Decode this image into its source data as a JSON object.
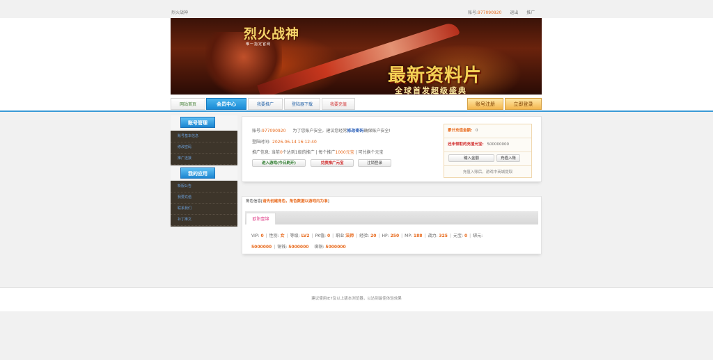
{
  "topbar": {
    "site_name": "烈火战神",
    "account_label": "账号:",
    "account_value": "977090920",
    "logout": "退出",
    "promote": "推广"
  },
  "banner": {
    "logo_text": "烈火战神",
    "logo_sub": "唯一指定官网",
    "headline": "最新资料片",
    "subline": "全球首发超级盛典"
  },
  "nav": {
    "tabs": [
      "网站首页",
      "会员中心",
      "我要推广",
      "登陆器下载",
      "我要充值"
    ],
    "register": "账号注册",
    "login": "立即登录"
  },
  "sidebar": {
    "account_head": "账号管理",
    "account_items": [
      "账号基本信息",
      "修改密码",
      "推广连接"
    ],
    "app_head": "我的应用",
    "app_items": [
      "新服公告",
      "我要充值",
      "联系我们",
      "补丁推文"
    ]
  },
  "account": {
    "account_label": "账号:",
    "account_value": "977090920",
    "security_prefix": "为了您账户安全，建议您经常",
    "security_link": "修改密码",
    "security_suffix": "确保账户安全!",
    "login_time_label": "登陆时间:",
    "login_time_value": "2026-06-14 16:12:40",
    "promo_prefix": "推广信息: 当前",
    "promo_count": "0",
    "promo_mid": "个达到1级的推广 | 每个推广",
    "promo_amount": "1000元宝",
    "promo_suffix": " | 可兑换个元宝",
    "btn_enter": "进入游戏(今日刷开)",
    "btn_exchange": "兑换推广元宝",
    "btn_logout": "注销登录"
  },
  "recharge": {
    "total_label": "累计充值金额:",
    "total_value": "0",
    "unclaimed_label": "还未领取的充值元宝:",
    "unclaimed_value": "500000000",
    "btn_input": "输入金额",
    "btn_recharge": "充值入账",
    "note": "充值入账后，游戏中商城提取"
  },
  "role": {
    "hint": "角色信息[请先创建角色，角色数据以游戏内为准]",
    "tab_name": "欧阳壹锦",
    "vip_label": "VIP:",
    "vip": "0",
    "gender_label": "性别:",
    "gender": "女",
    "level_label": "等级:",
    "level": "LV2",
    "pk_label": "PK值:",
    "pk": "0",
    "job_label": "职业",
    "job": "法师",
    "exp_label": "经验:",
    "exp": "20",
    "hp_label": "HP:",
    "hp": "250",
    "mp_label": "MP:",
    "mp": "188",
    "power_label": "战力:",
    "power": "325",
    "yuanbao_label": "元宝:",
    "yuanbao": "0",
    "bind_label": "绑元:",
    "bind": "5000000",
    "copper_label": "铜钱:",
    "copper": "5000000",
    "bindcopper_label": "绑铜:",
    "bindcopper": "5000000"
  },
  "footer": {
    "text": "建议使用IE7及以上版本浏览器，以达到最佳体验效果"
  }
}
